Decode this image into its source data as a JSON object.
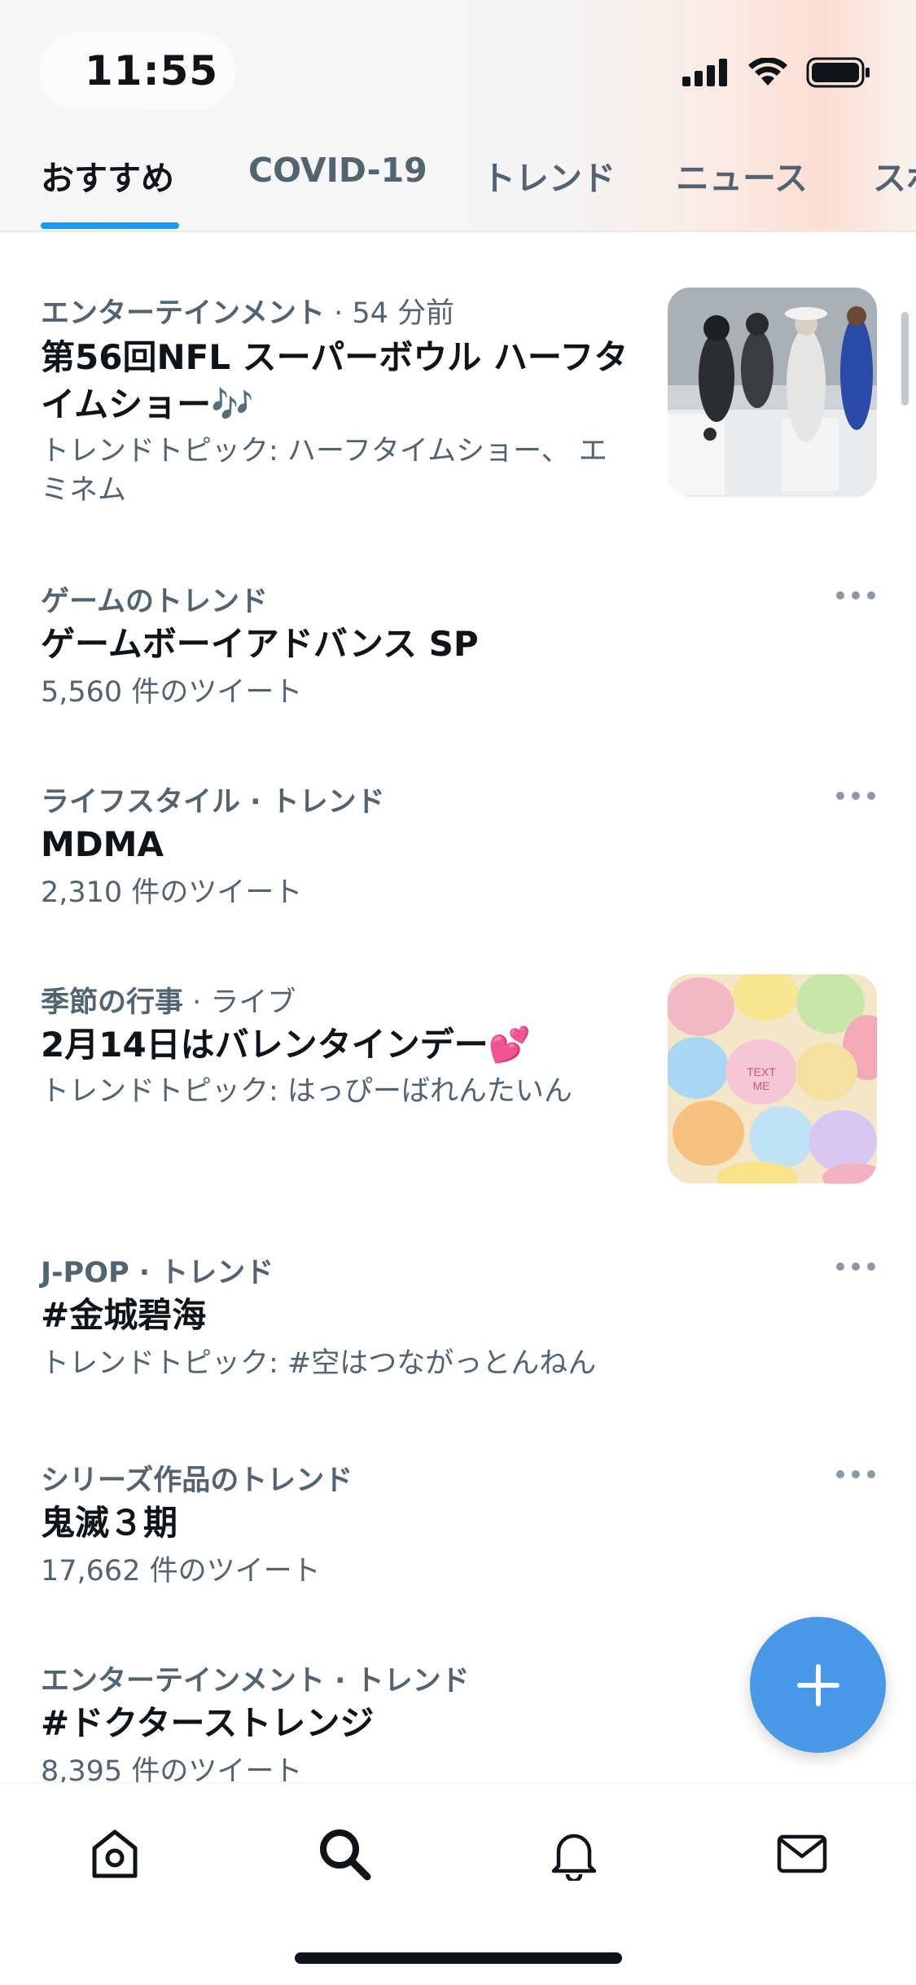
{
  "status_bar": {
    "time": "11:55"
  },
  "tabs": [
    {
      "label": "おすすめ",
      "active": true
    },
    {
      "label": "COVID-19",
      "active": false
    },
    {
      "label": "トレンド",
      "active": false
    },
    {
      "label": "ニュース",
      "active": false
    },
    {
      "label": "スポ",
      "active": false
    }
  ],
  "trends": [
    {
      "category": "エンターテインメント",
      "time": " · 54 分前",
      "title": "第56回NFL スーパーボウル ハーフタイムショー🎶",
      "subtitle": "トレンドトピック: ハーフタイムショー、 エミネム",
      "thumbnail": "halftime-show-photo"
    },
    {
      "category": "ゲームのトレンド",
      "title": "ゲームボーイアドバンス SP",
      "subtitle": "5,560 件のツイート"
    },
    {
      "category": "ライフスタイル · トレンド",
      "title": "MDMA",
      "subtitle": "2,310 件のツイート"
    },
    {
      "category": "季節の行事",
      "time": " · ライブ",
      "title": "2月14日はバレンタインデー💕",
      "subtitle": "トレンドトピック: はっぴーばれんたいん",
      "thumbnail": "candy-hearts-photo"
    },
    {
      "category": "J-POP · トレンド",
      "title": "#金城碧海",
      "subtitle": "トレンドトピック: #空はつながっとんねん"
    },
    {
      "category": "シリーズ作品のトレンド",
      "title": "鬼滅３期",
      "subtitle": "17,662 件のツイート"
    },
    {
      "category": "エンターテインメント · トレンド",
      "title": "#ドクターストレンジ",
      "subtitle": "8,395 件のツイート"
    }
  ],
  "bottom_nav": [
    "home-icon",
    "search-icon",
    "bell-icon",
    "mail-icon"
  ],
  "colors": {
    "accent": "#1d9bf0",
    "fab": "#4a99e9",
    "secondary_text": "#536471"
  }
}
